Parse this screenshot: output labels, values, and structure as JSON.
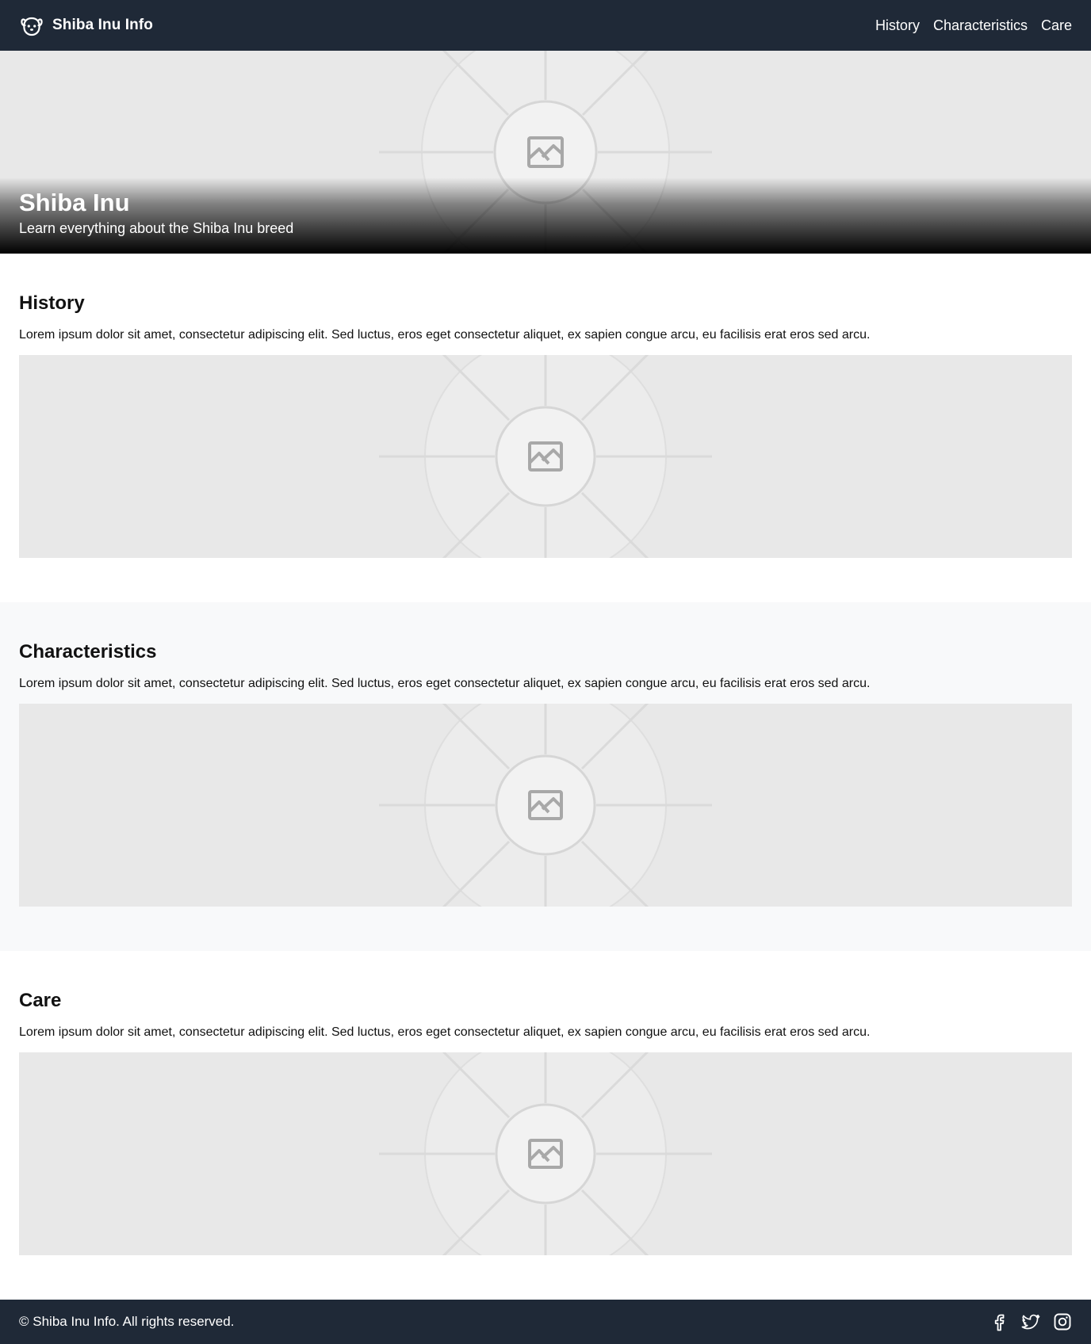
{
  "nav": {
    "brand": "Shiba Inu Info",
    "brand_icon": "dog-face-icon",
    "links": [
      "History",
      "Characteristics",
      "Care"
    ]
  },
  "hero": {
    "title": "Shiba Inu",
    "subtitle": "Learn everything about the Shiba Inu breed",
    "image_icon": "image-placeholder-icon"
  },
  "sections": [
    {
      "heading": "History",
      "text": "Lorem ipsum dolor sit amet, consectetur adipiscing elit. Sed luctus, eros eget consectetur aliquet, ex sapien congue arcu, eu facilisis erat eros sed arcu.",
      "image_icon": "image-placeholder-icon"
    },
    {
      "heading": "Characteristics",
      "text": "Lorem ipsum dolor sit amet, consectetur adipiscing elit. Sed luctus, eros eget consectetur aliquet, ex sapien congue arcu, eu facilisis erat eros sed arcu.",
      "image_icon": "image-placeholder-icon"
    },
    {
      "heading": "Care",
      "text": "Lorem ipsum dolor sit amet, consectetur adipiscing elit. Sed luctus, eros eget consectetur aliquet, ex sapien congue arcu, eu facilisis erat eros sed arcu.",
      "image_icon": "image-placeholder-icon"
    }
  ],
  "footer": {
    "copyright": "© Shiba Inu Info. All rights reserved.",
    "social_icons": [
      "facebook-icon",
      "twitter-icon",
      "instagram-icon"
    ]
  },
  "colors": {
    "nav_bg": "#1f2937",
    "placeholder_bg": "#e8e8e8",
    "alt_section_bg": "#f8f9fa",
    "text": "#111111"
  }
}
